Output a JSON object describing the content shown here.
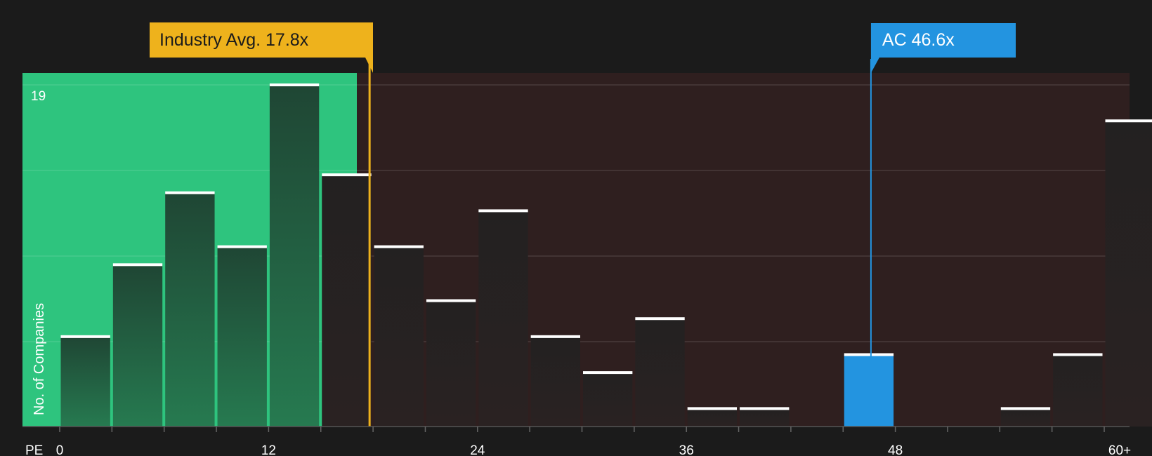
{
  "chart_data": {
    "type": "bar",
    "xlabel": "PE",
    "ylabel": "No. of Companies",
    "y_max_label": "19",
    "ylim": [
      0,
      20
    ],
    "x_ticks": [
      "0",
      "12",
      "24",
      "36",
      "48",
      "60+"
    ],
    "bins": [
      {
        "x": 0,
        "value": 5
      },
      {
        "x": 3,
        "value": 9
      },
      {
        "x": 6,
        "value": 13
      },
      {
        "x": 9,
        "value": 10
      },
      {
        "x": 12,
        "value": 19
      },
      {
        "x": 15,
        "value": 14
      },
      {
        "x": 18,
        "value": 10
      },
      {
        "x": 21,
        "value": 7
      },
      {
        "x": 24,
        "value": 12
      },
      {
        "x": 27,
        "value": 5
      },
      {
        "x": 30,
        "value": 3
      },
      {
        "x": 33,
        "value": 6
      },
      {
        "x": 36,
        "value": 1
      },
      {
        "x": 39,
        "value": 1
      },
      {
        "x": 45,
        "value": 4,
        "highlight": true
      },
      {
        "x": 54,
        "value": 1
      },
      {
        "x": 57,
        "value": 4
      },
      {
        "x": 60,
        "value": 17
      }
    ],
    "industry_avg": {
      "label": "Industry Avg. 17.8x",
      "value": 17.8
    },
    "company": {
      "label": "AC 46.6x",
      "value": 46.6
    },
    "colors": {
      "background": "#1b1b1b",
      "undervalued_zone": "#2ec47e",
      "overvalued_zone": "#2f1f1f",
      "bar_green_zone": "#1f4a34",
      "bar_dark": "#262323",
      "highlight_bar": "#2394e0",
      "industry_marker": "#eeb21c",
      "company_marker": "#2394e0",
      "bar_cap": "#ffffff"
    }
  }
}
